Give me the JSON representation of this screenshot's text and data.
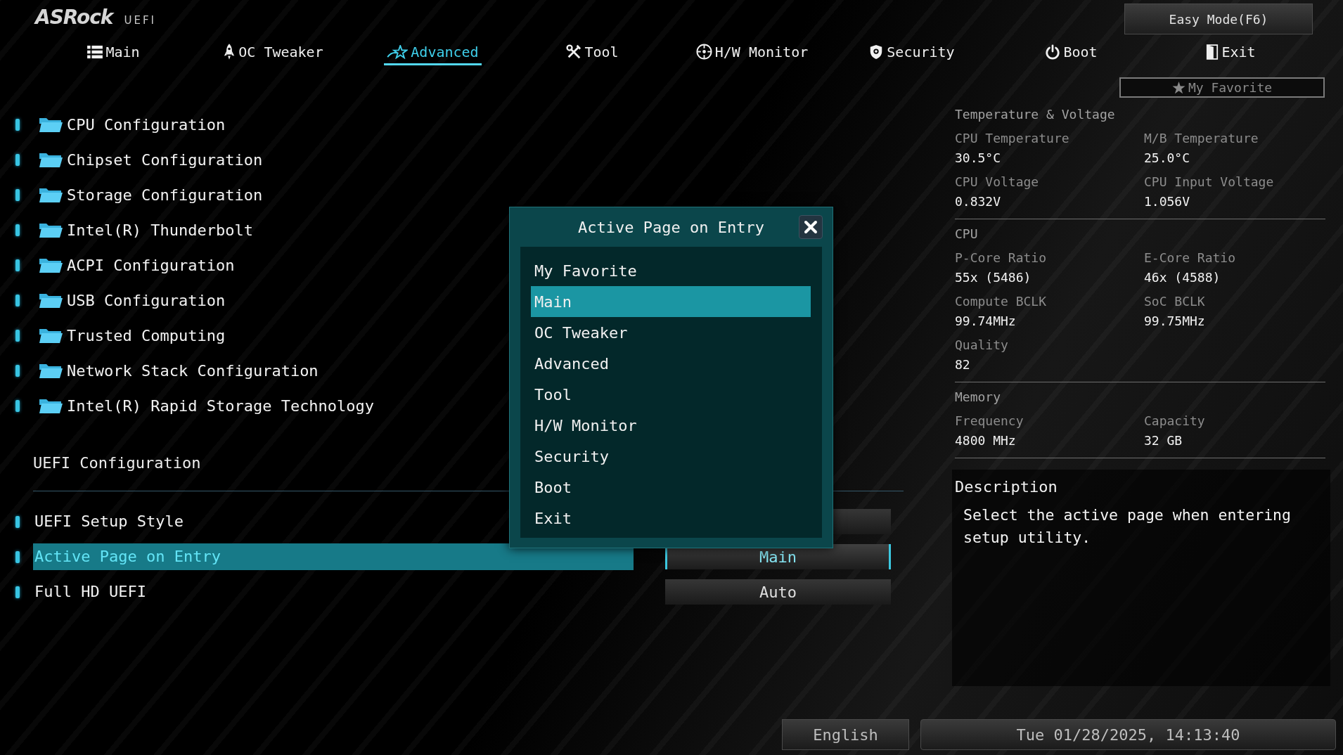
{
  "header": {
    "logo": "ASRock",
    "logo_suffix": "UEFI",
    "easy_mode_button": "Easy Mode(F6)"
  },
  "tabs": [
    {
      "label": "Main",
      "selected": false
    },
    {
      "label": "OC Tweaker",
      "selected": false
    },
    {
      "label": "Advanced",
      "selected": true
    },
    {
      "label": "Tool",
      "selected": false
    },
    {
      "label": "H/W Monitor",
      "selected": false
    },
    {
      "label": "Security",
      "selected": false
    },
    {
      "label": "Boot",
      "selected": false
    },
    {
      "label": "Exit",
      "selected": false
    }
  ],
  "favorite_button": "My Favorite",
  "menu_items": [
    "CPU Configuration",
    "Chipset Configuration",
    "Storage Configuration",
    "Intel(R) Thunderbolt",
    "ACPI Configuration",
    "USB Configuration",
    "Trusted Computing",
    "Network Stack Configuration",
    "Intel(R) Rapid Storage Technology"
  ],
  "uefi_section": {
    "title": "UEFI Configuration",
    "settings": [
      {
        "label": "UEFI Setup Style",
        "selected": false
      },
      {
        "label": "Active Page on Entry",
        "selected": true,
        "value": "Main"
      },
      {
        "label": "Full HD UEFI",
        "selected": false,
        "value": "Auto"
      }
    ]
  },
  "popup": {
    "title": "Active Page on Entry",
    "options": [
      {
        "label": "My Favorite",
        "selected": false
      },
      {
        "label": "Main",
        "selected": true
      },
      {
        "label": "OC Tweaker",
        "selected": false
      },
      {
        "label": "Advanced",
        "selected": false
      },
      {
        "label": "Tool",
        "selected": false
      },
      {
        "label": "H/W Monitor",
        "selected": false
      },
      {
        "label": "Security",
        "selected": false
      },
      {
        "label": "Boot",
        "selected": false
      },
      {
        "label": "Exit",
        "selected": false
      }
    ]
  },
  "info_panel": {
    "sections": [
      {
        "title": "Temperature & Voltage",
        "readings": [
          {
            "label": "CPU Temperature",
            "value": "30.5°C"
          },
          {
            "label": "M/B Temperature",
            "value": "25.0°C"
          },
          {
            "label": "CPU Voltage",
            "value": "0.832V"
          },
          {
            "label": "CPU Input Voltage",
            "value": "1.056V"
          }
        ]
      },
      {
        "title": "CPU",
        "readings": [
          {
            "label": "P-Core Ratio",
            "value": "55x (5486)"
          },
          {
            "label": "E-Core Ratio",
            "value": "46x (4588)"
          },
          {
            "label": "Compute BCLK",
            "value": "99.74MHz"
          },
          {
            "label": "SoC BCLK",
            "value": "99.75MHz"
          },
          {
            "label": "Quality",
            "value": "82"
          }
        ]
      },
      {
        "title": "Memory",
        "readings": [
          {
            "label": "Frequency",
            "value": "4800 MHz"
          },
          {
            "label": "Capacity",
            "value": "32 GB"
          }
        ]
      }
    ]
  },
  "description": {
    "title": "Description",
    "text": "Select the active page when entering setup utility."
  },
  "footer": {
    "language": "English",
    "datetime": "Tue 01/28/2025, 14:13:40"
  }
}
